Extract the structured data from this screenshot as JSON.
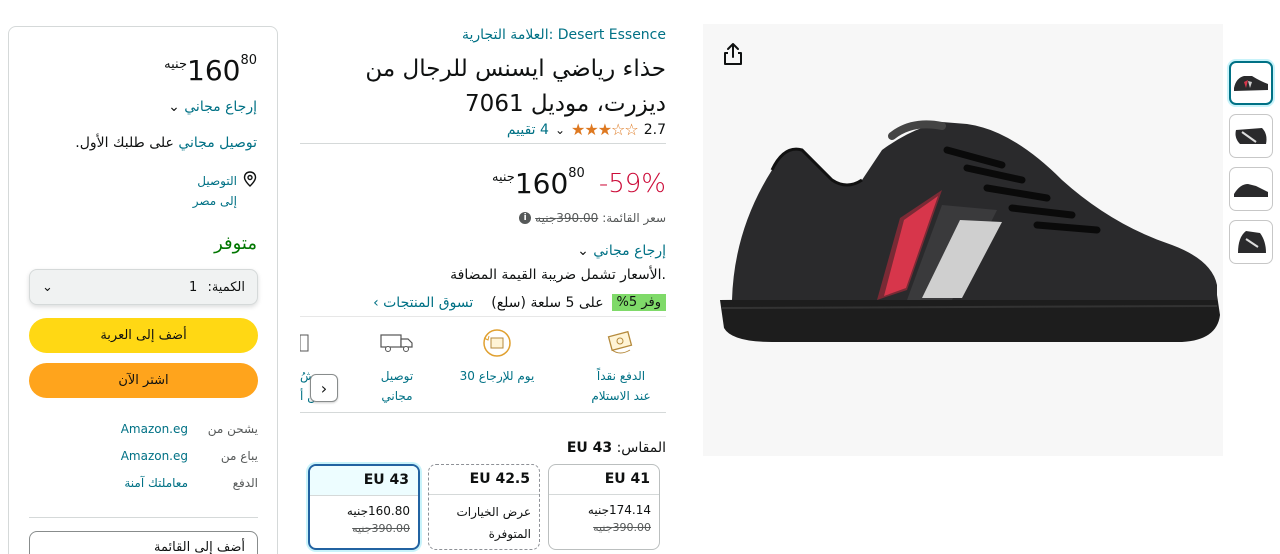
{
  "product": {
    "brand": "العلامة التجارية: Desert Essence",
    "title": "حذاء رياضي ايسنس للرجال من ديزرت، موديل 7061",
    "rating": "2.7",
    "stars": "★★★☆☆",
    "reviews": "4 تقييم",
    "discount": "-59%",
    "price_whole": "160",
    "price_fraction": "80",
    "currency": "جنيه",
    "list_price_label": "سعر القائمة:",
    "list_price": "390.00جنيه",
    "free_returns": "إرجاع مجاني",
    "vat_note": ".الأسعار تشمل ضريبة القيمة المضافة",
    "save_badge": "وفر 5%",
    "save_text": "على 5 سلعة (سلع)",
    "save_link": "تسوق المنتجات ›"
  },
  "features": [
    {
      "line1": "الدفع نقداً",
      "line2": "عند الاستلام",
      "icon": "cash-icon"
    },
    {
      "line1": "30 يوم للإرجاع",
      "line2": "",
      "icon": "return-box-icon"
    },
    {
      "line1": "توصيل",
      "line2": "مجاني",
      "icon": "delivery-truck-icon"
    },
    {
      "line1": "شُ",
      "line2": "من أ",
      "icon": "partial-icon"
    }
  ],
  "sizes": {
    "label": "المقاس:",
    "selected": "EU 43",
    "options": [
      {
        "size": "EU 41",
        "price": "174.14جنيه",
        "list": "390.00جنيه"
      },
      {
        "size": "EU 42.5",
        "line1": "عرض الخيارات",
        "line2": "المتوفرة"
      },
      {
        "size": "EU 43",
        "price": "160.80جنيه",
        "list": "390.00جنيه"
      }
    ]
  },
  "buybox": {
    "price_whole": "160",
    "price_fraction": "80",
    "currency": "جنيه",
    "free_returns": "إرجاع مجاني",
    "delivery_link": "توصيل مجاني",
    "delivery_text": " على طلبك الأول.",
    "location_line1": "التوصيل",
    "location_line2": "إلى مصر",
    "availability": "متوفر",
    "qty_label": "الكمية:",
    "qty_value": "1",
    "add_to_cart": "أضف إلى العربة",
    "buy_now": "اشتر الآن",
    "ships_from_label": "يشحن من",
    "ships_from": "Amazon.eg",
    "sold_by_label": "يباع من",
    "sold_by": "Amazon.eg",
    "payment_label": "الدفع",
    "payment": "معاملتك آمنة",
    "add_to_list": "أضف إلى القائمة"
  },
  "colors": {
    "link": "#007185",
    "discount": "#cc0c39",
    "availability": "#007600",
    "cart_button": "#ffd814",
    "buy_button": "#ffa41c",
    "star": "#de7921",
    "save_badge": "#7fda69"
  }
}
